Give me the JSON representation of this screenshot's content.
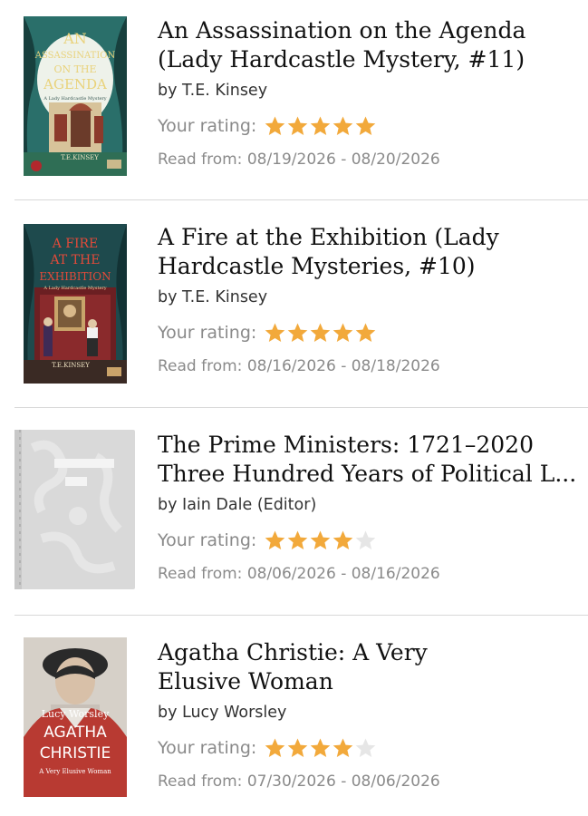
{
  "books": [
    {
      "title": "An Assassination on the Agenda\n(Lady Hardcastle Mystery, #11)",
      "author": "by T.E. Kinsey",
      "rating_label": "Your rating:",
      "rating": 5,
      "read_dates": "Read from: 08/19/2026 - 08/20/2026",
      "cover": {
        "title_lines": [
          "AN",
          "ASSASSINATION",
          "ON THE",
          "AGENDA"
        ],
        "series": "A Lady Hardcastle Mystery",
        "author": "T.E.KINSEY"
      }
    },
    {
      "title": "A Fire at the Exhibition (Lady\nHardcastle Mysteries, #10)",
      "author": "by T.E. Kinsey",
      "rating_label": "Your rating:",
      "rating": 5,
      "read_dates": "Read from: 08/16/2026 - 08/18/2026",
      "cover": {
        "title_lines": [
          "A FIRE",
          "AT THE",
          "EXHIBITION"
        ],
        "series": "A Lady Hardcastle Mystery",
        "author": "T.E.KINSEY"
      }
    },
    {
      "title": "The Prime Ministers: 1721–2020\nThree Hundred Years of Political L...",
      "author": "by Iain Dale (Editor)",
      "rating_label": "Your rating:",
      "rating": 4,
      "read_dates": "Read from: 08/06/2026 - 08/16/2026"
    },
    {
      "title": "Agatha Christie: A Very\nElusive Woman",
      "author": "by Lucy Worsley",
      "rating_label": "Your rating:",
      "rating": 4,
      "read_dates": "Read from: 07/30/2026 - 08/06/2026",
      "cover": {
        "author": "Lucy Worsley",
        "title_lines": [
          "AGATHA",
          "CHRISTIE"
        ],
        "subtitle": "A Very Elusive Woman"
      }
    }
  ],
  "max_rating": 5,
  "colors": {
    "star_filled": "#F2A93B",
    "star_empty": "#E6E6E6"
  }
}
